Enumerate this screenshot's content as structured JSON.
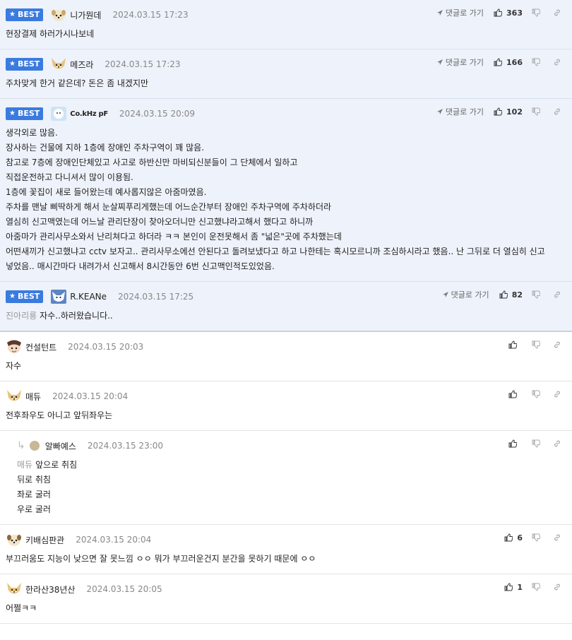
{
  "labels": {
    "best": "BEST",
    "reply_link": "댓글로 가기"
  },
  "colors": {
    "best_badge": "#3a7be0",
    "best_background": "#eef2fa"
  },
  "comments": [
    {
      "best": true,
      "nick": "니가뭔데",
      "date": "2024.03.15 17:23",
      "likes": "363",
      "body": "현장결제 하러가시나보네"
    },
    {
      "best": true,
      "nick": "메즈라",
      "date": "2024.03.15 17:23",
      "likes": "166",
      "body": "주차맞게 한거 같은데? 돈은 좀 내겠지만"
    },
    {
      "best": true,
      "nick": "Co.kHz pF",
      "date": "2024.03.15 20:09",
      "likes": "102",
      "body": "생각외로 많음.\n장사하는 건물에 지하 1층에 장애인 주차구역이 꽤 많음.\n참고로 7층에 장애인단체있고 사고로 하반신만 마비되신분들이 그 단체에서 일하고\n직접운전하고 다니셔서 많이 이용됨.\n1층에 꽃집이 새로 들어왔는데 예사롭지않은 아줌마였음.\n주차를 맨날 삐딱하게 해서 눈살찌푸리게했는데 어느순간부터 장애인 주차구역에 주차하더라\n열심히 신고맥였는데 어느날 관리단장이 찾아오더니만 신고했냐라고해서 했다고 하니까\n아줌마가 관리사무소와서 난리쳐다고 하더라 ㅋㅋ 본인이 운전못해서 좀 \"넓은\"곳에 주차했는데\n어떤새끼가 신고했냐고 cctv 보자고.. 관리사무소에선 안된다고 돌려보냈다고 하고 나한테는 혹시모르니까 조심하시라고 했음.. 난 그뒤로 더 열심히 신고 넣었음.. 매시간마다 내려가서 신고해서 8시간동안 6번 신고맥인적도있었음."
    },
    {
      "best": true,
      "nick": "R.KEANe",
      "date": "2024.03.15 17:25",
      "likes": "82",
      "mention": "진아리룡",
      "body": "자수..하러왔습니다.."
    },
    {
      "best": false,
      "nick": "컨설턴트",
      "date": "2024.03.15 20:03",
      "likes": "",
      "body": "자수"
    },
    {
      "best": false,
      "nick": "매듀",
      "date": "2024.03.15 20:04",
      "likes": "",
      "body": "전후좌우도 아니고 앞뒤좌우는"
    },
    {
      "best": false,
      "reply": true,
      "nick": "알빠예스",
      "date": "2024.03.15 23:00",
      "likes": "",
      "mention": "매듀",
      "body": "앞으로 취침\n뒤로 취침\n좌로 굴러\n우로 굴러"
    },
    {
      "best": false,
      "nick": "키배심판관",
      "date": "2024.03.15 20:04",
      "likes": "6",
      "body": "부끄러움도 지능이 낮으면 잘 못느낌 ㅇㅇ 뭐가 부끄러운건지 분간을 못하기 때문에 ㅇㅇ"
    },
    {
      "best": false,
      "nick": "한라산38년산",
      "date": "2024.03.15 20:05",
      "likes": "1",
      "body": "어쩔ㅋㅋ"
    }
  ]
}
